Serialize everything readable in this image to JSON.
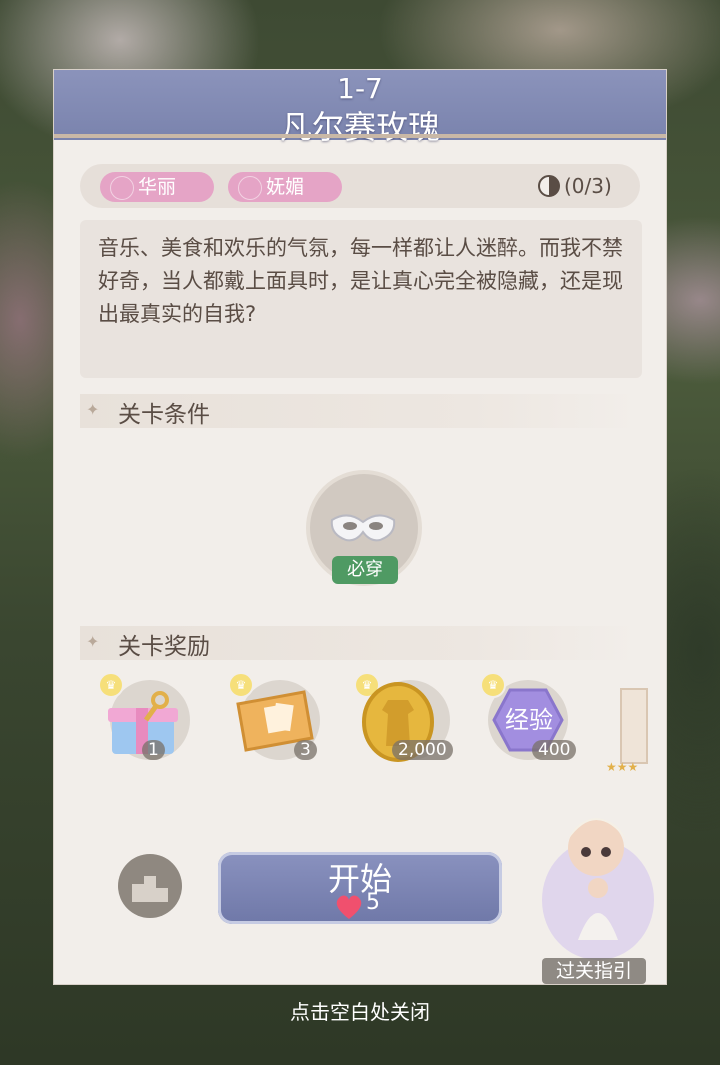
{
  "header": {
    "level": "1-7",
    "title": "凡尔赛玫瑰"
  },
  "tags": [
    "华丽",
    "妩媚"
  ],
  "progress": "(0/3)",
  "description": "音乐、美食和欢乐的气氛，每一样都让人迷醉。而我不禁好奇，当人都戴上面具时，是让真心完全被隐藏，还是现出最真实的自我?",
  "sections": {
    "conditions": "关卡条件",
    "rewards": "关卡奖励"
  },
  "requirement": {
    "badge": "必穿"
  },
  "rewards": [
    {
      "count": "1"
    },
    {
      "count": "3"
    },
    {
      "count": "2,000"
    },
    {
      "label": "经验",
      "count": "400"
    },
    {
      "stars": "★★★"
    }
  ],
  "start": {
    "label": "开始",
    "cost": "5"
  },
  "guide": "过关指引",
  "close_hint": "点击空白处关闭"
}
